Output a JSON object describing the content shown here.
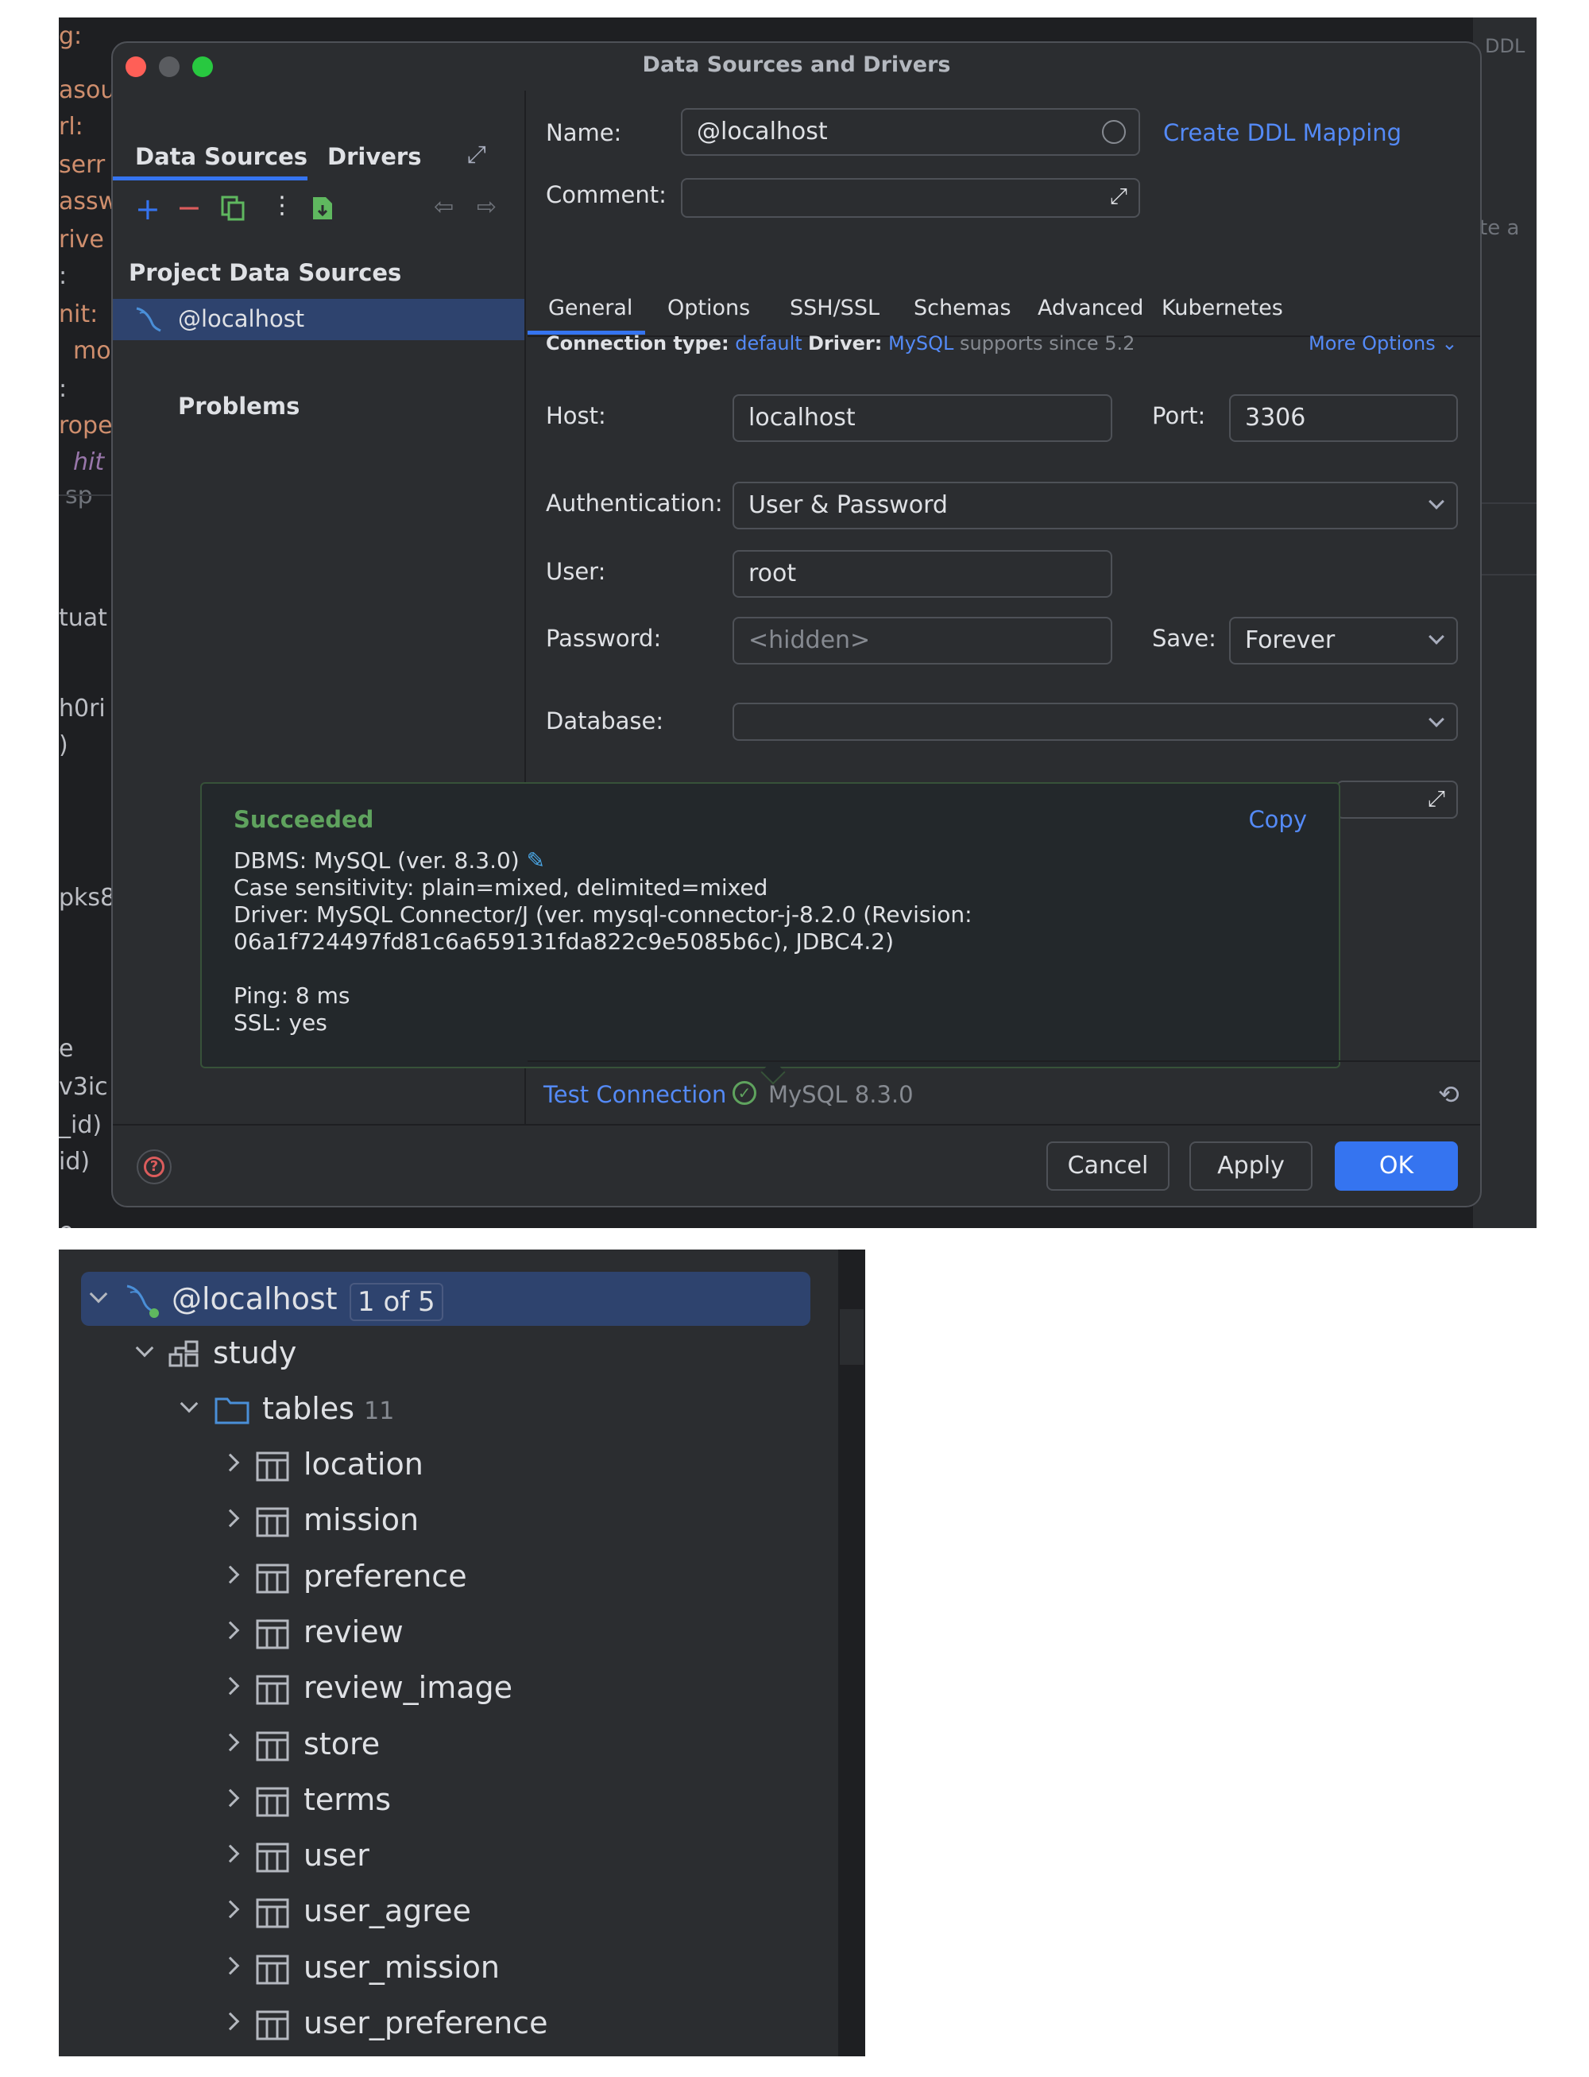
{
  "editor": {
    "code_lines": [
      "g:",
      "asou",
      "rl:",
      "serr",
      "assw",
      "rive",
      ":",
      "nit:",
      "moc",
      ":",
      "rope",
      "hit",
      "sp",
      "tuat",
      "h0ri",
      ")",
      "pks8",
      "e",
      "v3ic",
      "_id)",
      "id)",
      "e"
    ],
    "right_label": "DDL",
    "right_text": "te a"
  },
  "dialog": {
    "title": "Data Sources and Drivers",
    "left_tabs": [
      "Data Sources",
      "Drivers"
    ],
    "section_title": "Project Data Sources",
    "selected_source": "@localhost",
    "problems_label": "Problems",
    "name_label": "Name:",
    "name_value": "@localhost",
    "create_ddl_link": "Create DDL Mapping",
    "comment_label": "Comment:",
    "tabs": [
      "General",
      "Options",
      "SSH/SSL",
      "Schemas",
      "Advanced",
      "Kubernetes"
    ],
    "connection_type_label": "Connection type:",
    "connection_type_value": "default",
    "driver_label": "Driver:",
    "driver_value": "MySQL",
    "driver_note": "supports since 5.2",
    "more_options": "More Options",
    "host_label": "Host:",
    "host_value": "localhost",
    "port_label": "Port:",
    "port_value": "3306",
    "auth_label": "Authentication:",
    "auth_value": "User & Password",
    "user_label": "User:",
    "user_value": "root",
    "password_label": "Password:",
    "password_placeholder": "<hidden>",
    "save_label": "Save:",
    "save_value": "Forever",
    "database_label": "Database:",
    "test_connection": "Test Connection",
    "test_result": "MySQL 8.3.0",
    "buttons": {
      "cancel": "Cancel",
      "apply": "Apply",
      "ok": "OK"
    }
  },
  "popup": {
    "status": "Succeeded",
    "copy": "Copy",
    "lines": [
      "DBMS: MySQL (ver. 8.3.0)",
      "Case sensitivity: plain=mixed, delimited=mixed",
      "Driver: MySQL Connector/J (ver. mysql-connector-j-8.2.0 (Revision:",
      "06a1f724497fd81c6a659131fda822c9e5085b6c), JDBC4.2)",
      "Ping: 8 ms",
      "SSL: yes"
    ]
  },
  "tree": {
    "root": "@localhost",
    "root_badge": "1 of 5",
    "schema": "study",
    "folder": "tables",
    "folder_count": "11",
    "tables": [
      "location",
      "mission",
      "preference",
      "review",
      "review_image",
      "store",
      "terms",
      "user",
      "user_agree",
      "user_mission",
      "user_preference"
    ]
  },
  "colors": {
    "accent": "#3574f0",
    "success": "#5fa35e",
    "link": "#548af7",
    "selection": "#2e436e"
  }
}
